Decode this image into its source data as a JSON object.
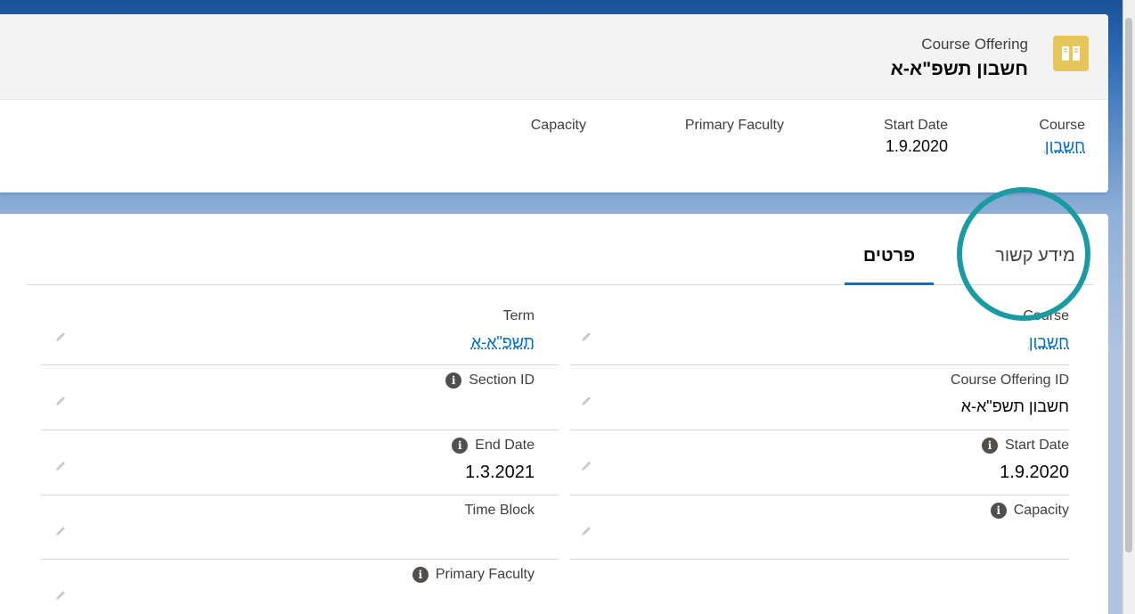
{
  "header": {
    "record_type": "Course Offering",
    "record_name": "חשבון תשפ\"א-א",
    "icon": "book-icon",
    "icon_color": "#e6c65b"
  },
  "highlights": [
    {
      "label": "Course",
      "value": "חשבון",
      "is_link": true
    },
    {
      "label": "Start Date",
      "value": "1.9.2020",
      "is_link": false
    },
    {
      "label": "Primary Faculty",
      "value": "",
      "is_link": false
    },
    {
      "label": "Capacity",
      "value": "",
      "is_link": false
    }
  ],
  "tabs": [
    {
      "label": "מידע קשור",
      "active": false
    },
    {
      "label": "פרטים",
      "active": true
    }
  ],
  "fields_right": [
    {
      "label": "Course",
      "value": "חשבון",
      "is_link": true,
      "info": false
    },
    {
      "label": "Course Offering ID",
      "value": "חשבון תשפ\"א-א",
      "is_link": false,
      "info": false
    },
    {
      "label": "Start Date",
      "value": "1.9.2020",
      "is_link": false,
      "info": true
    },
    {
      "label": "Capacity",
      "value": "",
      "is_link": false,
      "info": true
    }
  ],
  "fields_left": [
    {
      "label": "Term",
      "value": "תשפ\"א-א",
      "is_link": true,
      "info": false
    },
    {
      "label": "Section ID",
      "value": "",
      "is_link": false,
      "info": true
    },
    {
      "label": "End Date",
      "value": "1.3.2021",
      "is_link": false,
      "info": true
    },
    {
      "label": "Time Block",
      "value": "",
      "is_link": false,
      "info": false
    },
    {
      "label": "Primary Faculty",
      "value": "",
      "is_link": false,
      "info": true
    }
  ],
  "colors": {
    "accent": "#0070d2",
    "link": "#006dcc",
    "highlight_circle": "#1a9aa3"
  }
}
